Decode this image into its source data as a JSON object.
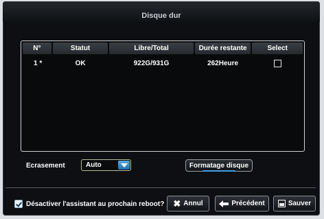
{
  "window": {
    "title": "Disque dur"
  },
  "table": {
    "headers": [
      "N°",
      "Statut",
      "Libre/Total",
      "Durée restante",
      "Select"
    ],
    "rows": [
      {
        "num": "1 *",
        "status": "OK",
        "free_total": "922G/931G",
        "remaining": "262Heure",
        "selected": false
      }
    ]
  },
  "overwrite": {
    "label": "Ecrasement",
    "value": "Auto"
  },
  "format_button": {
    "label": "Formatage disque"
  },
  "footer": {
    "wizard_checkbox": {
      "label": "Désactiver l'assistant au prochain reboot?",
      "checked": true
    },
    "cancel_label": "Annul",
    "previous_label": "Précédent",
    "save_label": "Sauver"
  },
  "colors": {
    "background": "#0d0f12",
    "accent": "#3fa0e8",
    "text": "#ffffff"
  },
  "icons": {
    "cancel": "x-icon",
    "previous": "arrow-left-icon",
    "save": "save-icon",
    "dropdown": "chevron-down-icon"
  }
}
